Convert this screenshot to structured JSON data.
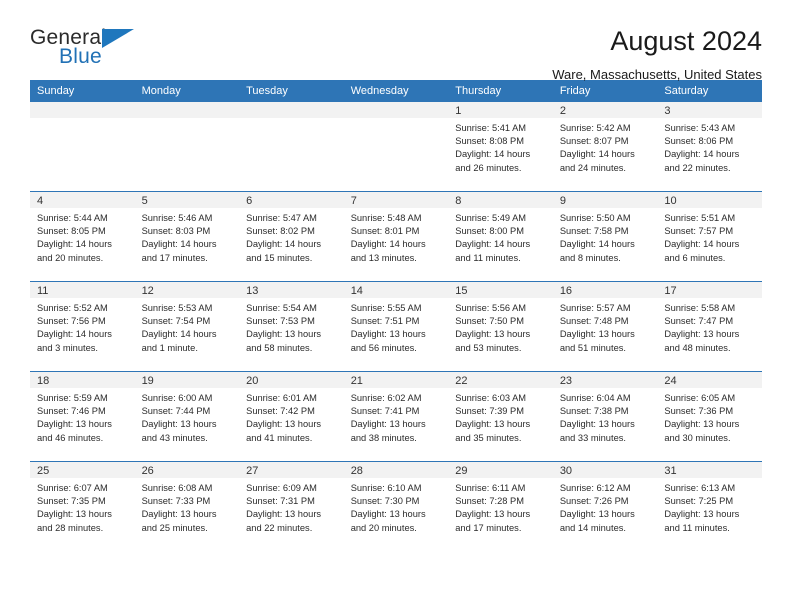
{
  "logo": {
    "word1": "General",
    "word2": "Blue",
    "triangle_color": "#1f77bd",
    "icon": "triangle-icon"
  },
  "header": {
    "title": "August 2024",
    "subtitle": "Ware, Massachusetts, United States"
  },
  "colors": {
    "header_blue": "#2e75b6",
    "daynum_gray": "#f2f2f2",
    "text": "#2b2b2b"
  },
  "weekday_headers": [
    "Sunday",
    "Monday",
    "Tuesday",
    "Wednesday",
    "Thursday",
    "Friday",
    "Saturday"
  ],
  "labels": {
    "sunrise": "Sunrise:",
    "sunset": "Sunset:",
    "daylight": "Daylight:"
  },
  "weeks": [
    [
      {
        "day": "",
        "sunrise": "",
        "sunset": "",
        "daylight_line1": "",
        "daylight_line2": ""
      },
      {
        "day": "",
        "sunrise": "",
        "sunset": "",
        "daylight_line1": "",
        "daylight_line2": ""
      },
      {
        "day": "",
        "sunrise": "",
        "sunset": "",
        "daylight_line1": "",
        "daylight_line2": ""
      },
      {
        "day": "",
        "sunrise": "",
        "sunset": "",
        "daylight_line1": "",
        "daylight_line2": ""
      },
      {
        "day": "1",
        "sunrise": "Sunrise: 5:41 AM",
        "sunset": "Sunset: 8:08 PM",
        "daylight_line1": "Daylight: 14 hours",
        "daylight_line2": "and 26 minutes."
      },
      {
        "day": "2",
        "sunrise": "Sunrise: 5:42 AM",
        "sunset": "Sunset: 8:07 PM",
        "daylight_line1": "Daylight: 14 hours",
        "daylight_line2": "and 24 minutes."
      },
      {
        "day": "3",
        "sunrise": "Sunrise: 5:43 AM",
        "sunset": "Sunset: 8:06 PM",
        "daylight_line1": "Daylight: 14 hours",
        "daylight_line2": "and 22 minutes."
      }
    ],
    [
      {
        "day": "4",
        "sunrise": "Sunrise: 5:44 AM",
        "sunset": "Sunset: 8:05 PM",
        "daylight_line1": "Daylight: 14 hours",
        "daylight_line2": "and 20 minutes."
      },
      {
        "day": "5",
        "sunrise": "Sunrise: 5:46 AM",
        "sunset": "Sunset: 8:03 PM",
        "daylight_line1": "Daylight: 14 hours",
        "daylight_line2": "and 17 minutes."
      },
      {
        "day": "6",
        "sunrise": "Sunrise: 5:47 AM",
        "sunset": "Sunset: 8:02 PM",
        "daylight_line1": "Daylight: 14 hours",
        "daylight_line2": "and 15 minutes."
      },
      {
        "day": "7",
        "sunrise": "Sunrise: 5:48 AM",
        "sunset": "Sunset: 8:01 PM",
        "daylight_line1": "Daylight: 14 hours",
        "daylight_line2": "and 13 minutes."
      },
      {
        "day": "8",
        "sunrise": "Sunrise: 5:49 AM",
        "sunset": "Sunset: 8:00 PM",
        "daylight_line1": "Daylight: 14 hours",
        "daylight_line2": "and 11 minutes."
      },
      {
        "day": "9",
        "sunrise": "Sunrise: 5:50 AM",
        "sunset": "Sunset: 7:58 PM",
        "daylight_line1": "Daylight: 14 hours",
        "daylight_line2": "and 8 minutes."
      },
      {
        "day": "10",
        "sunrise": "Sunrise: 5:51 AM",
        "sunset": "Sunset: 7:57 PM",
        "daylight_line1": "Daylight: 14 hours",
        "daylight_line2": "and 6 minutes."
      }
    ],
    [
      {
        "day": "11",
        "sunrise": "Sunrise: 5:52 AM",
        "sunset": "Sunset: 7:56 PM",
        "daylight_line1": "Daylight: 14 hours",
        "daylight_line2": "and 3 minutes."
      },
      {
        "day": "12",
        "sunrise": "Sunrise: 5:53 AM",
        "sunset": "Sunset: 7:54 PM",
        "daylight_line1": "Daylight: 14 hours",
        "daylight_line2": "and 1 minute."
      },
      {
        "day": "13",
        "sunrise": "Sunrise: 5:54 AM",
        "sunset": "Sunset: 7:53 PM",
        "daylight_line1": "Daylight: 13 hours",
        "daylight_line2": "and 58 minutes."
      },
      {
        "day": "14",
        "sunrise": "Sunrise: 5:55 AM",
        "sunset": "Sunset: 7:51 PM",
        "daylight_line1": "Daylight: 13 hours",
        "daylight_line2": "and 56 minutes."
      },
      {
        "day": "15",
        "sunrise": "Sunrise: 5:56 AM",
        "sunset": "Sunset: 7:50 PM",
        "daylight_line1": "Daylight: 13 hours",
        "daylight_line2": "and 53 minutes."
      },
      {
        "day": "16",
        "sunrise": "Sunrise: 5:57 AM",
        "sunset": "Sunset: 7:48 PM",
        "daylight_line1": "Daylight: 13 hours",
        "daylight_line2": "and 51 minutes."
      },
      {
        "day": "17",
        "sunrise": "Sunrise: 5:58 AM",
        "sunset": "Sunset: 7:47 PM",
        "daylight_line1": "Daylight: 13 hours",
        "daylight_line2": "and 48 minutes."
      }
    ],
    [
      {
        "day": "18",
        "sunrise": "Sunrise: 5:59 AM",
        "sunset": "Sunset: 7:46 PM",
        "daylight_line1": "Daylight: 13 hours",
        "daylight_line2": "and 46 minutes."
      },
      {
        "day": "19",
        "sunrise": "Sunrise: 6:00 AM",
        "sunset": "Sunset: 7:44 PM",
        "daylight_line1": "Daylight: 13 hours",
        "daylight_line2": "and 43 minutes."
      },
      {
        "day": "20",
        "sunrise": "Sunrise: 6:01 AM",
        "sunset": "Sunset: 7:42 PM",
        "daylight_line1": "Daylight: 13 hours",
        "daylight_line2": "and 41 minutes."
      },
      {
        "day": "21",
        "sunrise": "Sunrise: 6:02 AM",
        "sunset": "Sunset: 7:41 PM",
        "daylight_line1": "Daylight: 13 hours",
        "daylight_line2": "and 38 minutes."
      },
      {
        "day": "22",
        "sunrise": "Sunrise: 6:03 AM",
        "sunset": "Sunset: 7:39 PM",
        "daylight_line1": "Daylight: 13 hours",
        "daylight_line2": "and 35 minutes."
      },
      {
        "day": "23",
        "sunrise": "Sunrise: 6:04 AM",
        "sunset": "Sunset: 7:38 PM",
        "daylight_line1": "Daylight: 13 hours",
        "daylight_line2": "and 33 minutes."
      },
      {
        "day": "24",
        "sunrise": "Sunrise: 6:05 AM",
        "sunset": "Sunset: 7:36 PM",
        "daylight_line1": "Daylight: 13 hours",
        "daylight_line2": "and 30 minutes."
      }
    ],
    [
      {
        "day": "25",
        "sunrise": "Sunrise: 6:07 AM",
        "sunset": "Sunset: 7:35 PM",
        "daylight_line1": "Daylight: 13 hours",
        "daylight_line2": "and 28 minutes."
      },
      {
        "day": "26",
        "sunrise": "Sunrise: 6:08 AM",
        "sunset": "Sunset: 7:33 PM",
        "daylight_line1": "Daylight: 13 hours",
        "daylight_line2": "and 25 minutes."
      },
      {
        "day": "27",
        "sunrise": "Sunrise: 6:09 AM",
        "sunset": "Sunset: 7:31 PM",
        "daylight_line1": "Daylight: 13 hours",
        "daylight_line2": "and 22 minutes."
      },
      {
        "day": "28",
        "sunrise": "Sunrise: 6:10 AM",
        "sunset": "Sunset: 7:30 PM",
        "daylight_line1": "Daylight: 13 hours",
        "daylight_line2": "and 20 minutes."
      },
      {
        "day": "29",
        "sunrise": "Sunrise: 6:11 AM",
        "sunset": "Sunset: 7:28 PM",
        "daylight_line1": "Daylight: 13 hours",
        "daylight_line2": "and 17 minutes."
      },
      {
        "day": "30",
        "sunrise": "Sunrise: 6:12 AM",
        "sunset": "Sunset: 7:26 PM",
        "daylight_line1": "Daylight: 13 hours",
        "daylight_line2": "and 14 minutes."
      },
      {
        "day": "31",
        "sunrise": "Sunrise: 6:13 AM",
        "sunset": "Sunset: 7:25 PM",
        "daylight_line1": "Daylight: 13 hours",
        "daylight_line2": "and 11 minutes."
      }
    ]
  ]
}
